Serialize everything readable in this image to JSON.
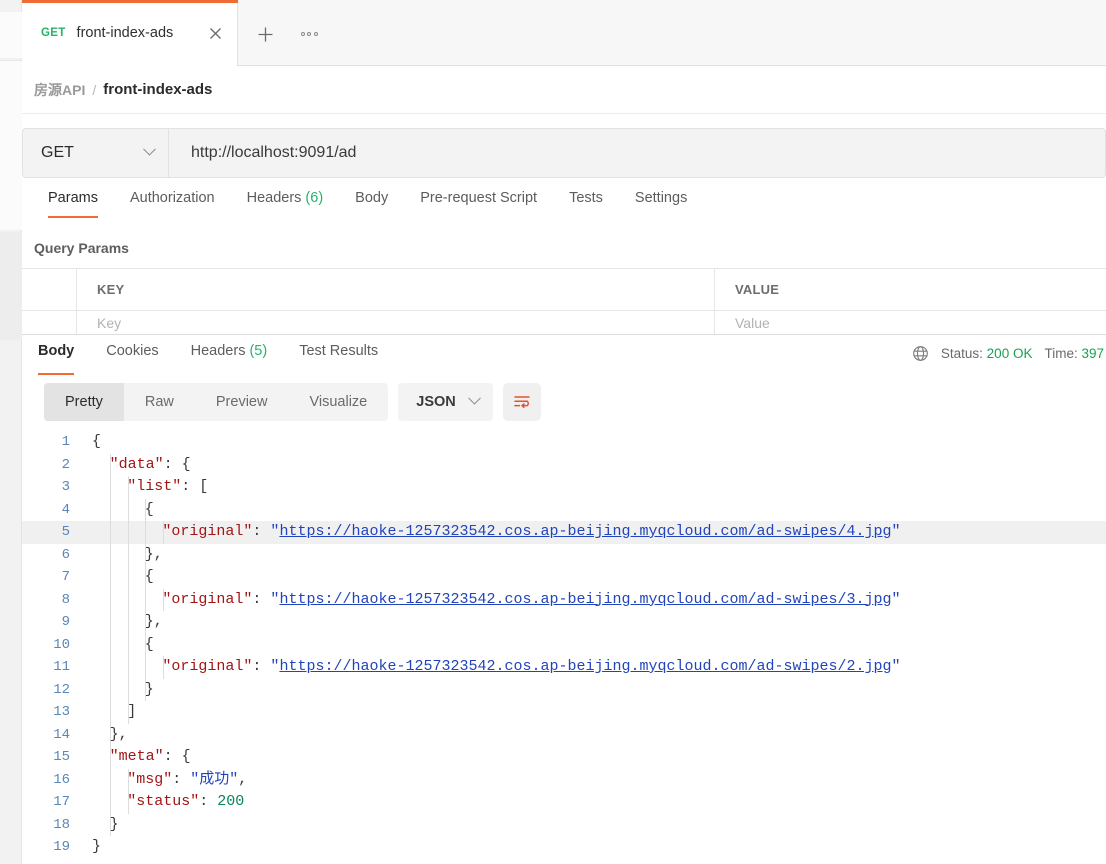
{
  "window": {
    "tab": {
      "method": "GET",
      "title": "front-index-ads",
      "close_icon": "close-icon",
      "new_tab_icon": "plus-icon",
      "more_icon": "more-horizontal-icon"
    }
  },
  "breadcrumb": {
    "collection": "房源API",
    "separator": "/",
    "current": "front-index-ads"
  },
  "request": {
    "method": "GET",
    "url": "http://localhost:9091/ad",
    "tabs": [
      {
        "label": "Params",
        "count": "",
        "active": true
      },
      {
        "label": "Authorization",
        "count": "",
        "active": false
      },
      {
        "label": "Headers",
        "count": "(6)",
        "active": false
      },
      {
        "label": "Body",
        "count": "",
        "active": false
      },
      {
        "label": "Pre-request Script",
        "count": "",
        "active": false
      },
      {
        "label": "Tests",
        "count": "",
        "active": false
      },
      {
        "label": "Settings",
        "count": "",
        "active": false
      }
    ],
    "query_params": {
      "section_title": "Query Params",
      "columns": [
        "KEY",
        "VALUE"
      ],
      "placeholder_row": {
        "key": "Key",
        "value": "Value"
      }
    }
  },
  "response": {
    "tabs": [
      {
        "label": "Body",
        "count": "",
        "active": true
      },
      {
        "label": "Cookies",
        "count": "",
        "active": false
      },
      {
        "label": "Headers",
        "count": "(5)",
        "active": false
      },
      {
        "label": "Test Results",
        "count": "",
        "active": false
      }
    ],
    "status": {
      "globe_icon": "globe-icon",
      "status_label": "Status:",
      "status_value": "200 OK",
      "time_label": "Time:",
      "time_value": "397"
    },
    "format_bar": {
      "views": [
        {
          "label": "Pretty",
          "active": true
        },
        {
          "label": "Raw",
          "active": false
        },
        {
          "label": "Preview",
          "active": false
        },
        {
          "label": "Visualize",
          "active": false
        }
      ],
      "language": "JSON",
      "language_chevron": "chevron-down-icon",
      "wrap_icon": "word-wrap-icon"
    },
    "body": {
      "urls": [
        "https://haoke-1257323542.cos.ap-beijing.myqcloud.com/ad-swipes/4.jpg",
        "https://haoke-1257323542.cos.ap-beijing.myqcloud.com/ad-swipes/3.jpg",
        "https://haoke-1257323542.cos.ap-beijing.myqcloud.com/ad-swipes/2.jpg"
      ],
      "meta_msg": "成功",
      "meta_status": "200",
      "lines": [
        {
          "n": "1",
          "indent": 0,
          "guides": 0,
          "parts": [
            {
              "t": "{",
              "c": "pun"
            }
          ]
        },
        {
          "n": "2",
          "indent": 2,
          "guides": 1,
          "parts": [
            {
              "t": "\"data\"",
              "c": "key"
            },
            {
              "t": ": {",
              "c": "pun"
            }
          ]
        },
        {
          "n": "3",
          "indent": 4,
          "guides": 2,
          "parts": [
            {
              "t": "\"list\"",
              "c": "key"
            },
            {
              "t": ": [",
              "c": "pun"
            }
          ]
        },
        {
          "n": "4",
          "indent": 6,
          "guides": 3,
          "parts": [
            {
              "t": "{",
              "c": "pun"
            }
          ]
        },
        {
          "n": "5",
          "indent": 8,
          "guides": 4,
          "hl": true,
          "parts": [
            {
              "t": "\"original\"",
              "c": "key"
            },
            {
              "t": ": ",
              "c": "pun"
            },
            {
              "t": "\"",
              "c": "str"
            },
            {
              "t": "https://haoke-1257323542.cos.ap-beijing.myqcloud.com/ad-swipes/4.jpg",
              "c": "link"
            },
            {
              "t": "\"",
              "c": "str"
            }
          ]
        },
        {
          "n": "6",
          "indent": 6,
          "guides": 3,
          "parts": [
            {
              "t": "},",
              "c": "pun"
            }
          ]
        },
        {
          "n": "7",
          "indent": 6,
          "guides": 3,
          "parts": [
            {
              "t": "{",
              "c": "pun"
            }
          ]
        },
        {
          "n": "8",
          "indent": 8,
          "guides": 4,
          "parts": [
            {
              "t": "\"original\"",
              "c": "key"
            },
            {
              "t": ": ",
              "c": "pun"
            },
            {
              "t": "\"",
              "c": "str"
            },
            {
              "t": "https://haoke-1257323542.cos.ap-beijing.myqcloud.com/ad-swipes/3.jpg",
              "c": "link"
            },
            {
              "t": "\"",
              "c": "str"
            }
          ]
        },
        {
          "n": "9",
          "indent": 6,
          "guides": 3,
          "parts": [
            {
              "t": "},",
              "c": "pun"
            }
          ]
        },
        {
          "n": "10",
          "indent": 6,
          "guides": 3,
          "parts": [
            {
              "t": "{",
              "c": "pun"
            }
          ]
        },
        {
          "n": "11",
          "indent": 8,
          "guides": 4,
          "parts": [
            {
              "t": "\"original\"",
              "c": "key"
            },
            {
              "t": ": ",
              "c": "pun"
            },
            {
              "t": "\"",
              "c": "str"
            },
            {
              "t": "https://haoke-1257323542.cos.ap-beijing.myqcloud.com/ad-swipes/2.jpg",
              "c": "link"
            },
            {
              "t": "\"",
              "c": "str"
            }
          ]
        },
        {
          "n": "12",
          "indent": 6,
          "guides": 3,
          "parts": [
            {
              "t": "}",
              "c": "pun"
            }
          ]
        },
        {
          "n": "13",
          "indent": 4,
          "guides": 2,
          "parts": [
            {
              "t": "]",
              "c": "pun"
            }
          ]
        },
        {
          "n": "14",
          "indent": 2,
          "guides": 1,
          "parts": [
            {
              "t": "},",
              "c": "pun"
            }
          ]
        },
        {
          "n": "15",
          "indent": 2,
          "guides": 1,
          "parts": [
            {
              "t": "\"meta\"",
              "c": "key"
            },
            {
              "t": ": {",
              "c": "pun"
            }
          ]
        },
        {
          "n": "16",
          "indent": 4,
          "guides": 2,
          "parts": [
            {
              "t": "\"msg\"",
              "c": "key"
            },
            {
              "t": ": ",
              "c": "pun"
            },
            {
              "t": "\"成功\"",
              "c": "str"
            },
            {
              "t": ",",
              "c": "pun"
            }
          ]
        },
        {
          "n": "17",
          "indent": 4,
          "guides": 2,
          "parts": [
            {
              "t": "\"status\"",
              "c": "key"
            },
            {
              "t": ": ",
              "c": "pun"
            },
            {
              "t": "200",
              "c": "num"
            }
          ]
        },
        {
          "n": "18",
          "indent": 2,
          "guides": 1,
          "parts": [
            {
              "t": "}",
              "c": "pun"
            }
          ]
        },
        {
          "n": "19",
          "indent": 0,
          "guides": 0,
          "parts": [
            {
              "t": "}",
              "c": "pun"
            }
          ]
        }
      ]
    }
  },
  "colors": {
    "accent": "#ef6c37",
    "success": "#26b26b",
    "json_key": "#a31515",
    "json_string": "#2244bb",
    "json_number": "#098658"
  }
}
